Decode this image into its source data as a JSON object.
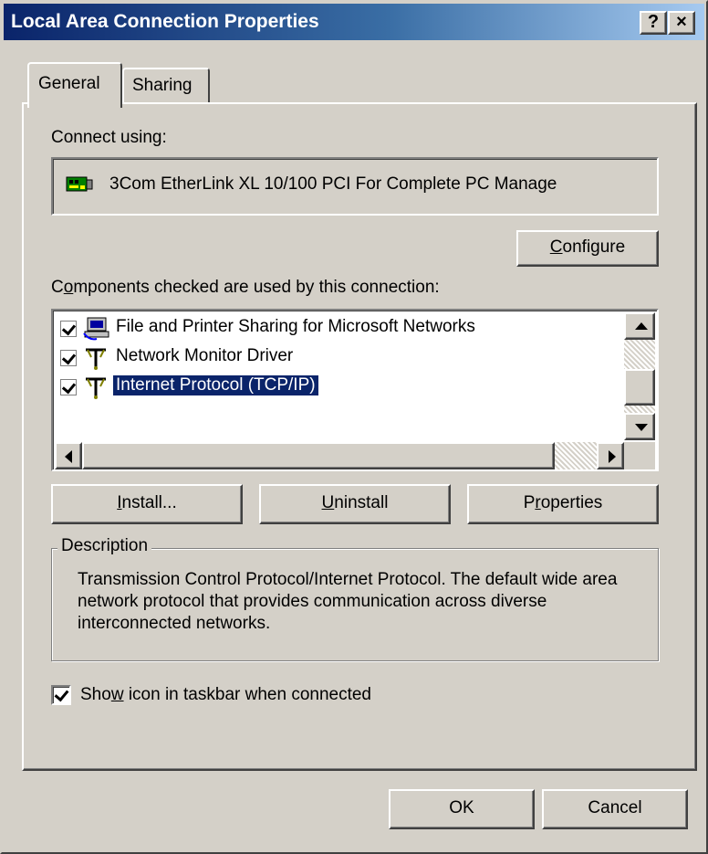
{
  "window": {
    "title": "Local Area Connection Properties",
    "help_label": "?",
    "close_label": "×"
  },
  "tabs": [
    {
      "label": "General",
      "selected": true
    },
    {
      "label": "Sharing",
      "selected": false
    }
  ],
  "connect": {
    "label": "Connect using:",
    "adapter": "3Com EtherLink XL 10/100 PCI For Complete PC Manage",
    "adapter_icon": "network-card-icon"
  },
  "configure": {
    "pre": "",
    "accel": "C",
    "post": "onfigure"
  },
  "components": {
    "label_pre": "C",
    "label_accel": "o",
    "label_post": "mponents checked are used by this connection:",
    "items": [
      {
        "label": "File and Printer Sharing for Microsoft Networks",
        "checked": true,
        "icon": "computer-share-icon",
        "selected": false
      },
      {
        "label": "Network Monitor Driver",
        "checked": true,
        "icon": "network-protocol-icon",
        "selected": false
      },
      {
        "label": "Internet Protocol (TCP/IP)",
        "checked": true,
        "icon": "network-protocol-icon",
        "selected": true
      }
    ]
  },
  "buttons": {
    "install": {
      "pre": "",
      "accel": "I",
      "post": "nstall..."
    },
    "uninstall": {
      "pre": "",
      "accel": "U",
      "post": "ninstall"
    },
    "properties": {
      "pre": "P",
      "accel": "r",
      "post": "operties"
    }
  },
  "description": {
    "title": "Description",
    "text": "Transmission Control Protocol/Internet Protocol. The default wide area network protocol that provides communication across diverse interconnected networks."
  },
  "show_icon": {
    "pre": "Sho",
    "accel": "w",
    "post": " icon in taskbar when connected",
    "checked": true
  },
  "footer": {
    "ok_label": "OK",
    "cancel_label": "Cancel"
  },
  "colors": {
    "title_start": "#0a246a",
    "title_end": "#a6caf0",
    "selection": "#0a246a",
    "face": "#d4d0c8"
  }
}
